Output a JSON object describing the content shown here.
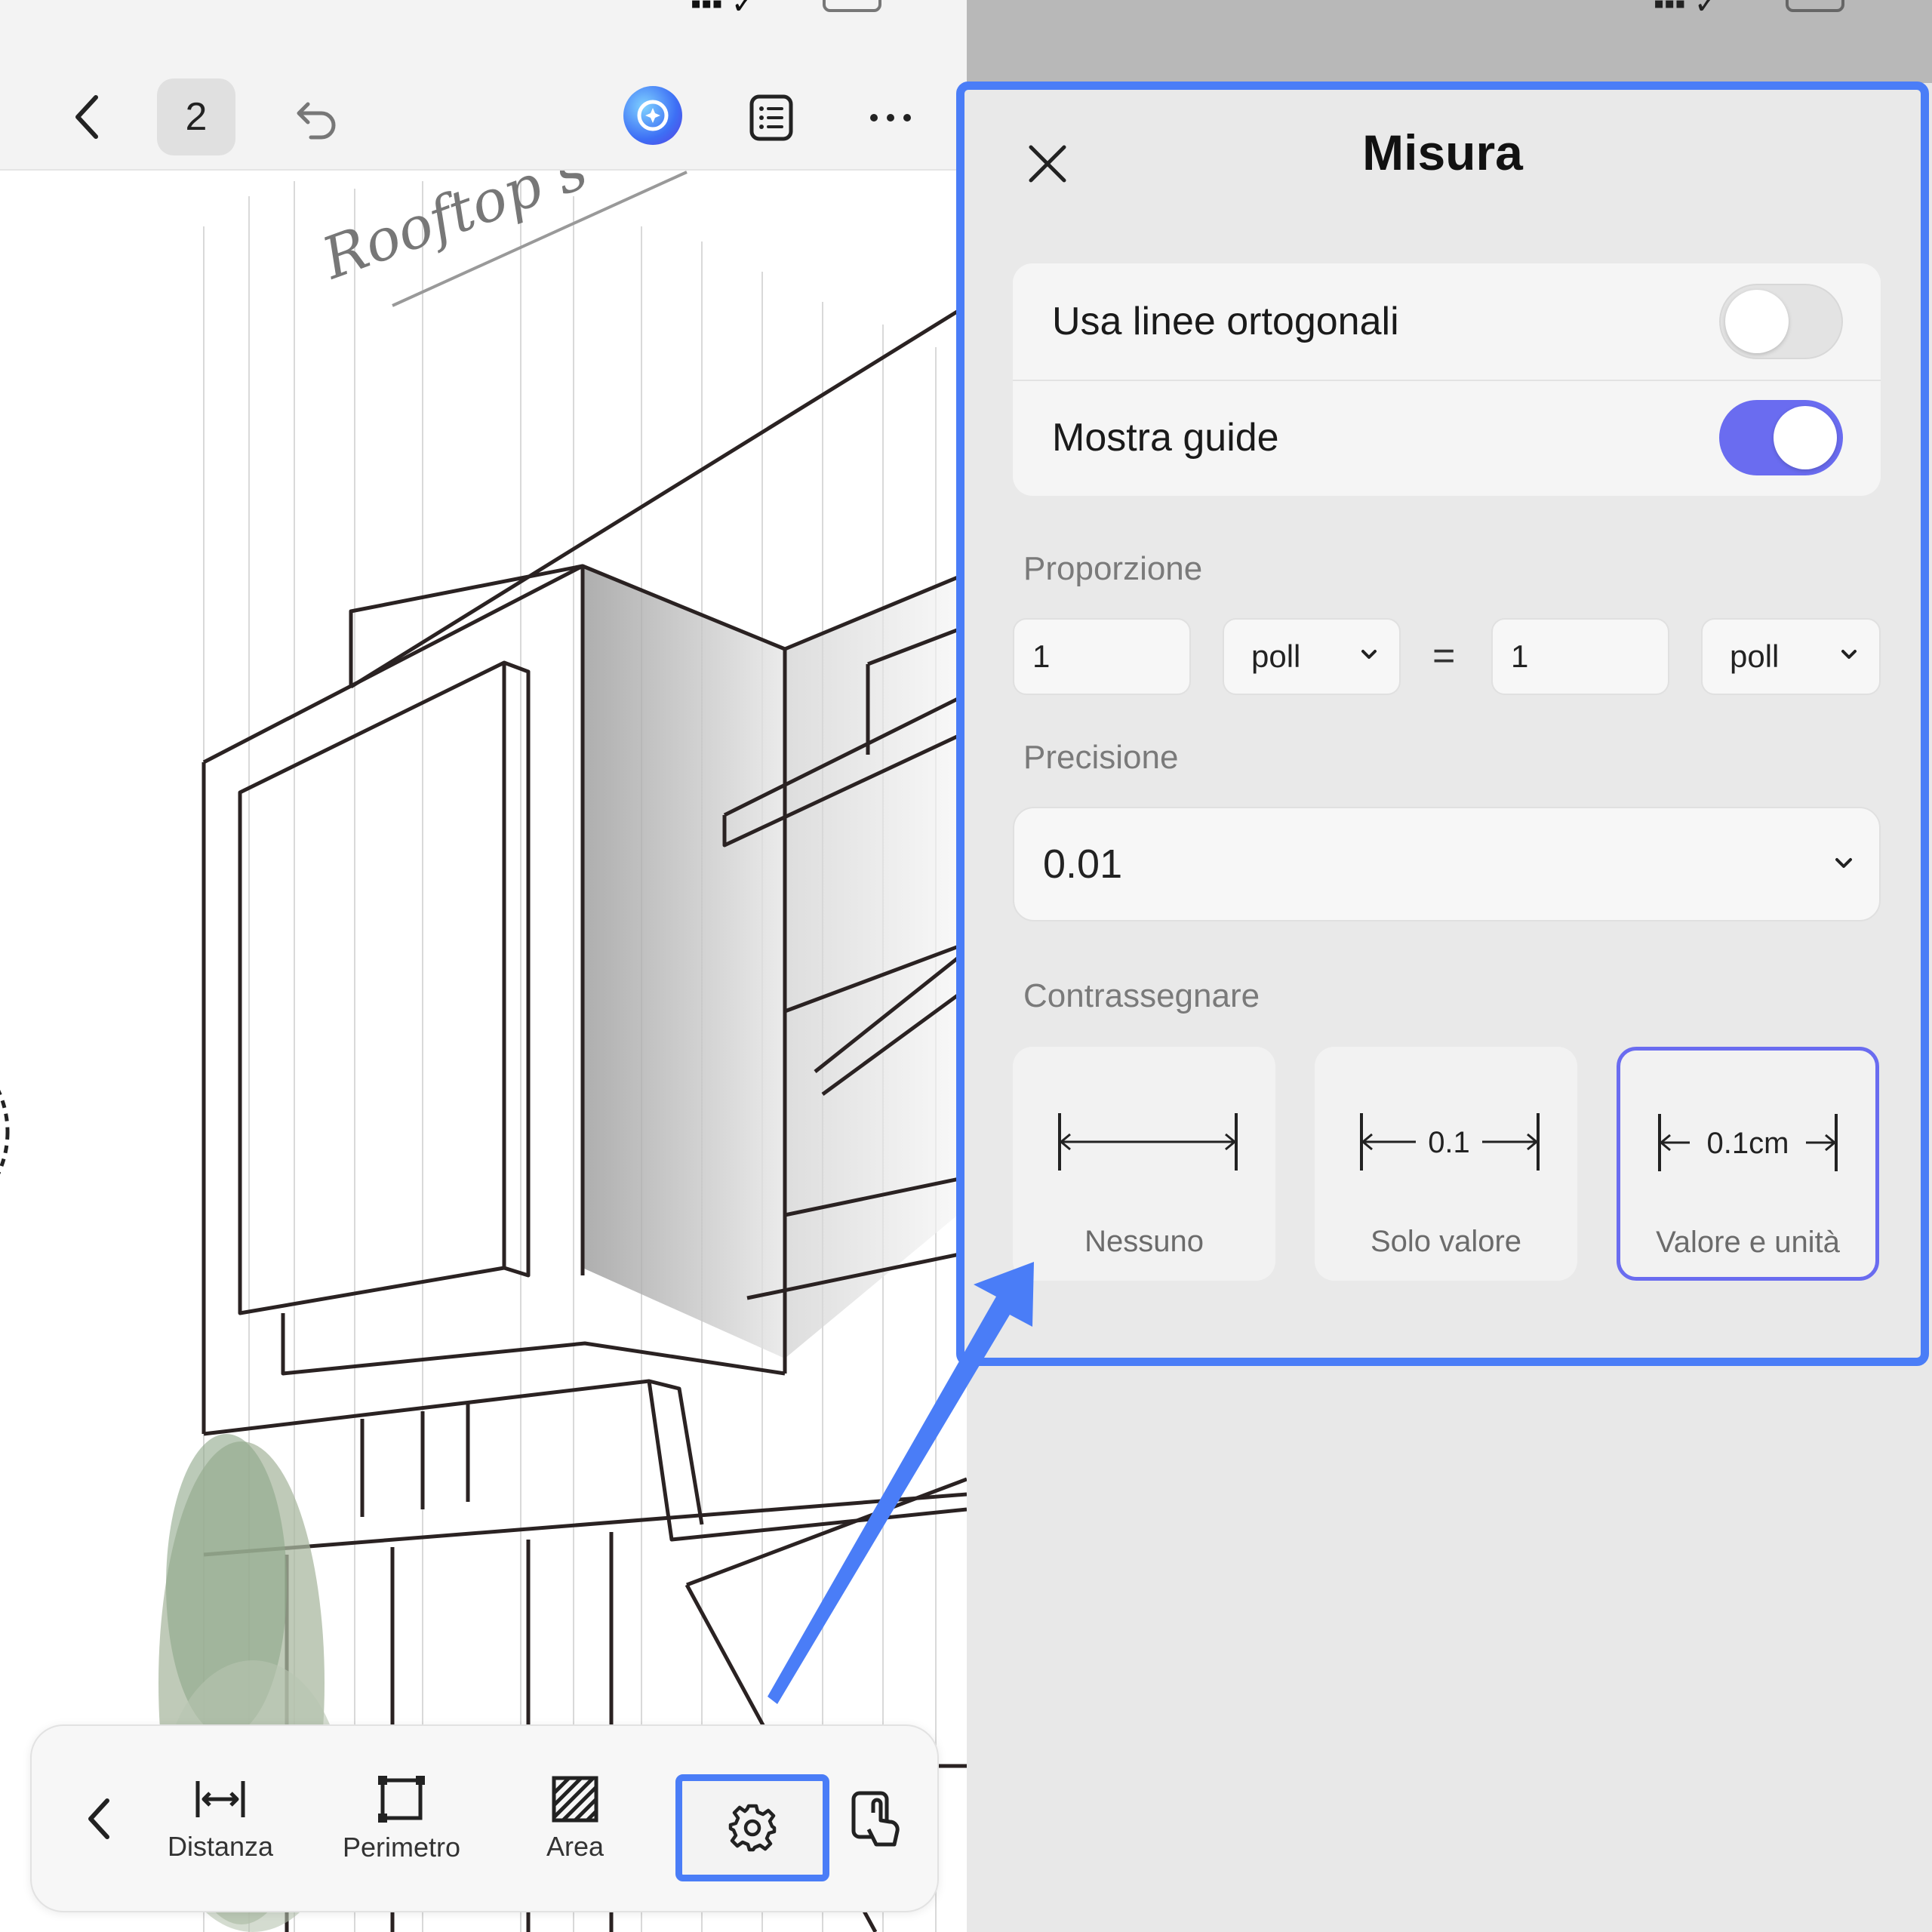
{
  "left_app": {
    "page_number": "2",
    "drawing_text": "Rooftop s",
    "bottom_toolbar": {
      "distance_label": "Distanza",
      "perimeter_label": "Perimetro",
      "area_label": "Area"
    }
  },
  "panel": {
    "title": "Misura",
    "toggles": [
      {
        "label": "Usa linee ortogonali",
        "state": "off"
      },
      {
        "label": "Mostra guide",
        "state": "on"
      }
    ],
    "proportion": {
      "label": "Proporzione",
      "left_value": "1",
      "left_unit": "poll",
      "equals": "=",
      "right_value": "1",
      "right_unit": "poll"
    },
    "precision": {
      "label": "Precisione",
      "value": "0.01"
    },
    "marking": {
      "label": "Contrassegnare",
      "options": [
        {
          "label": "Nessuno",
          "sample": "",
          "selected": false
        },
        {
          "label": "Solo valore",
          "sample": "0.1",
          "selected": false
        },
        {
          "label": "Valore e unità",
          "sample": "0.1cm",
          "selected": true
        }
      ]
    }
  },
  "colors": {
    "highlight": "#4a7df7",
    "accent": "#6a6cf0"
  }
}
